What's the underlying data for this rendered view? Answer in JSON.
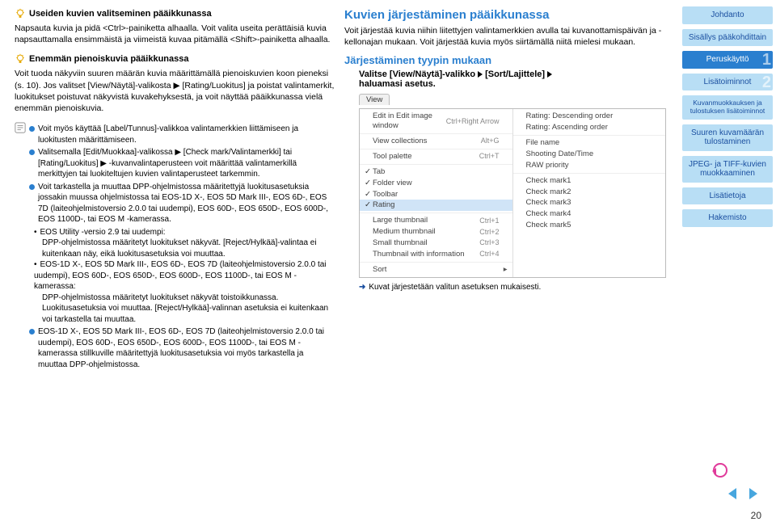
{
  "left": {
    "tip1_title": "Useiden kuvien valitseminen pääikkunassa",
    "tip1_body": "Napsauta kuvia ja pidä <Ctrl>-painiketta alhaalla. Voit valita useita perättäisiä kuvia napsauttamalla ensimmäistä ja viimeistä kuvaa pitämällä <Shift>-painiketta alhaalla.",
    "tip2_title": "Enemmän pienoiskuvia pääikkunassa",
    "tip2_body": "Voit tuoda näkyviin suuren määrän kuvia määrittämällä pienoiskuvien koon pieneksi (s. 10). Jos valitset [View/Näytä]-valikosta ▶ [Rating/Luokitus] ja poistat valintamerkit, luokitukset poistuvat näkyvistä kuvakehyksestä, ja voit näyttää pääikkunassa vielä enemmän pienoiskuvia.",
    "b1": "Voit myös käyttää [Label/Tunnus]-valikkoa valintamerkkien liittämiseen ja luokitusten määrittämiseen.",
    "b2": "Valitsemalla [Edit/Muokkaa]-valikossa ▶ [Check mark/Valintamerkki] tai [Rating/Luokitus] ▶ -kuvanvalintaperusteen voit määrittää valintamerkillä merkittyjen tai luokiteltujen kuvien valintaperusteet tarkemmin.",
    "b3": "Voit tarkastella ja muuttaa DPP-ohjelmistossa määritettyjä luokitusasetuksia jossakin muussa ohjelmistossa tai EOS-1D X-, EOS 5D Mark III-, EOS 6D-, EOS 7D (laiteohjelmistoversio 2.0.0 tai uudempi), EOS 60D-, EOS 650D-, EOS 600D-, EOS 1100D-, tai EOS M -kamerassa.",
    "s1": "EOS Utility -versio 2.9 tai uudempi:",
    "s1b": "DPP-ohjelmistossa määritetyt luokitukset näkyvät. [Reject/Hylkää]-valintaa ei kuitenkaan näy, eikä luokitusasetuksia voi muuttaa.",
    "s2": "EOS-1D X-, EOS 5D Mark III-, EOS 6D-, EOS 7D (laiteohjelmistoversio 2.0.0 tai uudempi), EOS 60D-, EOS 650D-, EOS 600D-, EOS 1100D-, tai EOS M -kamerassa:",
    "s2b": "DPP-ohjelmistossa määritetyt luokitukset näkyvät toistoikkunassa. Luokitusasetuksia voi muuttaa. [Reject/Hylkää]-valinnan asetuksia ei kuitenkaan voi tarkastella tai muuttaa.",
    "b4": "EOS-1D X-, EOS 5D Mark III-, EOS 6D-, EOS 7D (laiteohjelmistoversio 2.0.0 tai uudempi), EOS 60D-, EOS 650D-, EOS 600D-, EOS 1100D-, tai EOS M -kamerassa stillkuville määritettyjä luokitusasetuksia voi myös tarkastella ja muuttaa DPP-ohjelmistossa."
  },
  "right": {
    "h2": "Kuvien järjestäminen pääikkunassa",
    "intro": "Voit järjestää kuvia niihin liitettyjen valintamerkkien avulla tai kuvanottamispäivän ja -kellonajan mukaan. Voit järjestää kuvia myös siirtämällä niitä mielesi mukaan.",
    "h3": "Järjestäminen tyypin mukaan",
    "step_pre": "Valitse [View/Näytä]-valikko",
    "step_mid": "[Sort/Lajittele]",
    "step_end": "haluamasi asetus.",
    "view_tab": "View",
    "result": "Kuvat järjestetään valitun asetuksen mukaisesti."
  },
  "menu": {
    "left": [
      {
        "chk": "",
        "label": "Edit in Edit image window",
        "sc": "Ctrl+Right Arrow",
        "arrow": ""
      },
      {
        "chk": "",
        "label": "View collections",
        "sc": "Alt+G",
        "arrow": "",
        "sep": true
      },
      {
        "chk": "",
        "label": "Tool palette",
        "sc": "Ctrl+T",
        "arrow": "",
        "sep": true
      },
      {
        "chk": "✓",
        "label": "Tab",
        "sc": "",
        "arrow": "",
        "sep": true
      },
      {
        "chk": "✓",
        "label": "Folder view",
        "sc": "",
        "arrow": ""
      },
      {
        "chk": "✓",
        "label": "Toolbar",
        "sc": "",
        "arrow": ""
      },
      {
        "chk": "✓",
        "label": "Rating",
        "sc": "",
        "arrow": "",
        "hl": true
      },
      {
        "chk": "",
        "label": "Large thumbnail",
        "sc": "Ctrl+1",
        "arrow": "",
        "sep": true
      },
      {
        "chk": "",
        "label": "Medium thumbnail",
        "sc": "Ctrl+2",
        "arrow": ""
      },
      {
        "chk": "",
        "label": "Small thumbnail",
        "sc": "Ctrl+3",
        "arrow": ""
      },
      {
        "chk": "",
        "label": "Thumbnail with information",
        "sc": "Ctrl+4",
        "arrow": ""
      },
      {
        "chk": "",
        "label": "Sort",
        "sc": "",
        "arrow": "▸",
        "sep": true
      }
    ],
    "right": [
      {
        "label": "Rating: Descending order"
      },
      {
        "label": "Rating: Ascending order"
      },
      {
        "label": "File name",
        "sep": true
      },
      {
        "label": "Shooting Date/Time"
      },
      {
        "label": "RAW priority"
      },
      {
        "label": "Check mark1",
        "sep": true
      },
      {
        "label": "Check mark2"
      },
      {
        "label": "Check mark3"
      },
      {
        "label": "Check mark4"
      },
      {
        "label": "Check mark5"
      }
    ]
  },
  "sidebar": {
    "items": [
      {
        "label": "Johdanto",
        "dark": false
      },
      {
        "label": "Sisällys pääkohdittain",
        "dark": false
      },
      {
        "label": "Peruskäyttö",
        "num": "1",
        "dark": true
      },
      {
        "label": "Lisätoiminnot",
        "num": "2",
        "dark": false
      },
      {
        "label": "Kuvanmuokkauksen ja tulostuksen lisätoiminnot",
        "dark": false,
        "small": true
      },
      {
        "label": "Suuren kuvamäärän tulostaminen",
        "dark": false
      },
      {
        "label": "JPEG- ja TIFF-kuvien muokkaaminen",
        "dark": false
      },
      {
        "label": "Lisätietoja",
        "dark": false
      },
      {
        "label": "Hakemisto",
        "dark": false
      }
    ]
  },
  "pagenum": "20"
}
